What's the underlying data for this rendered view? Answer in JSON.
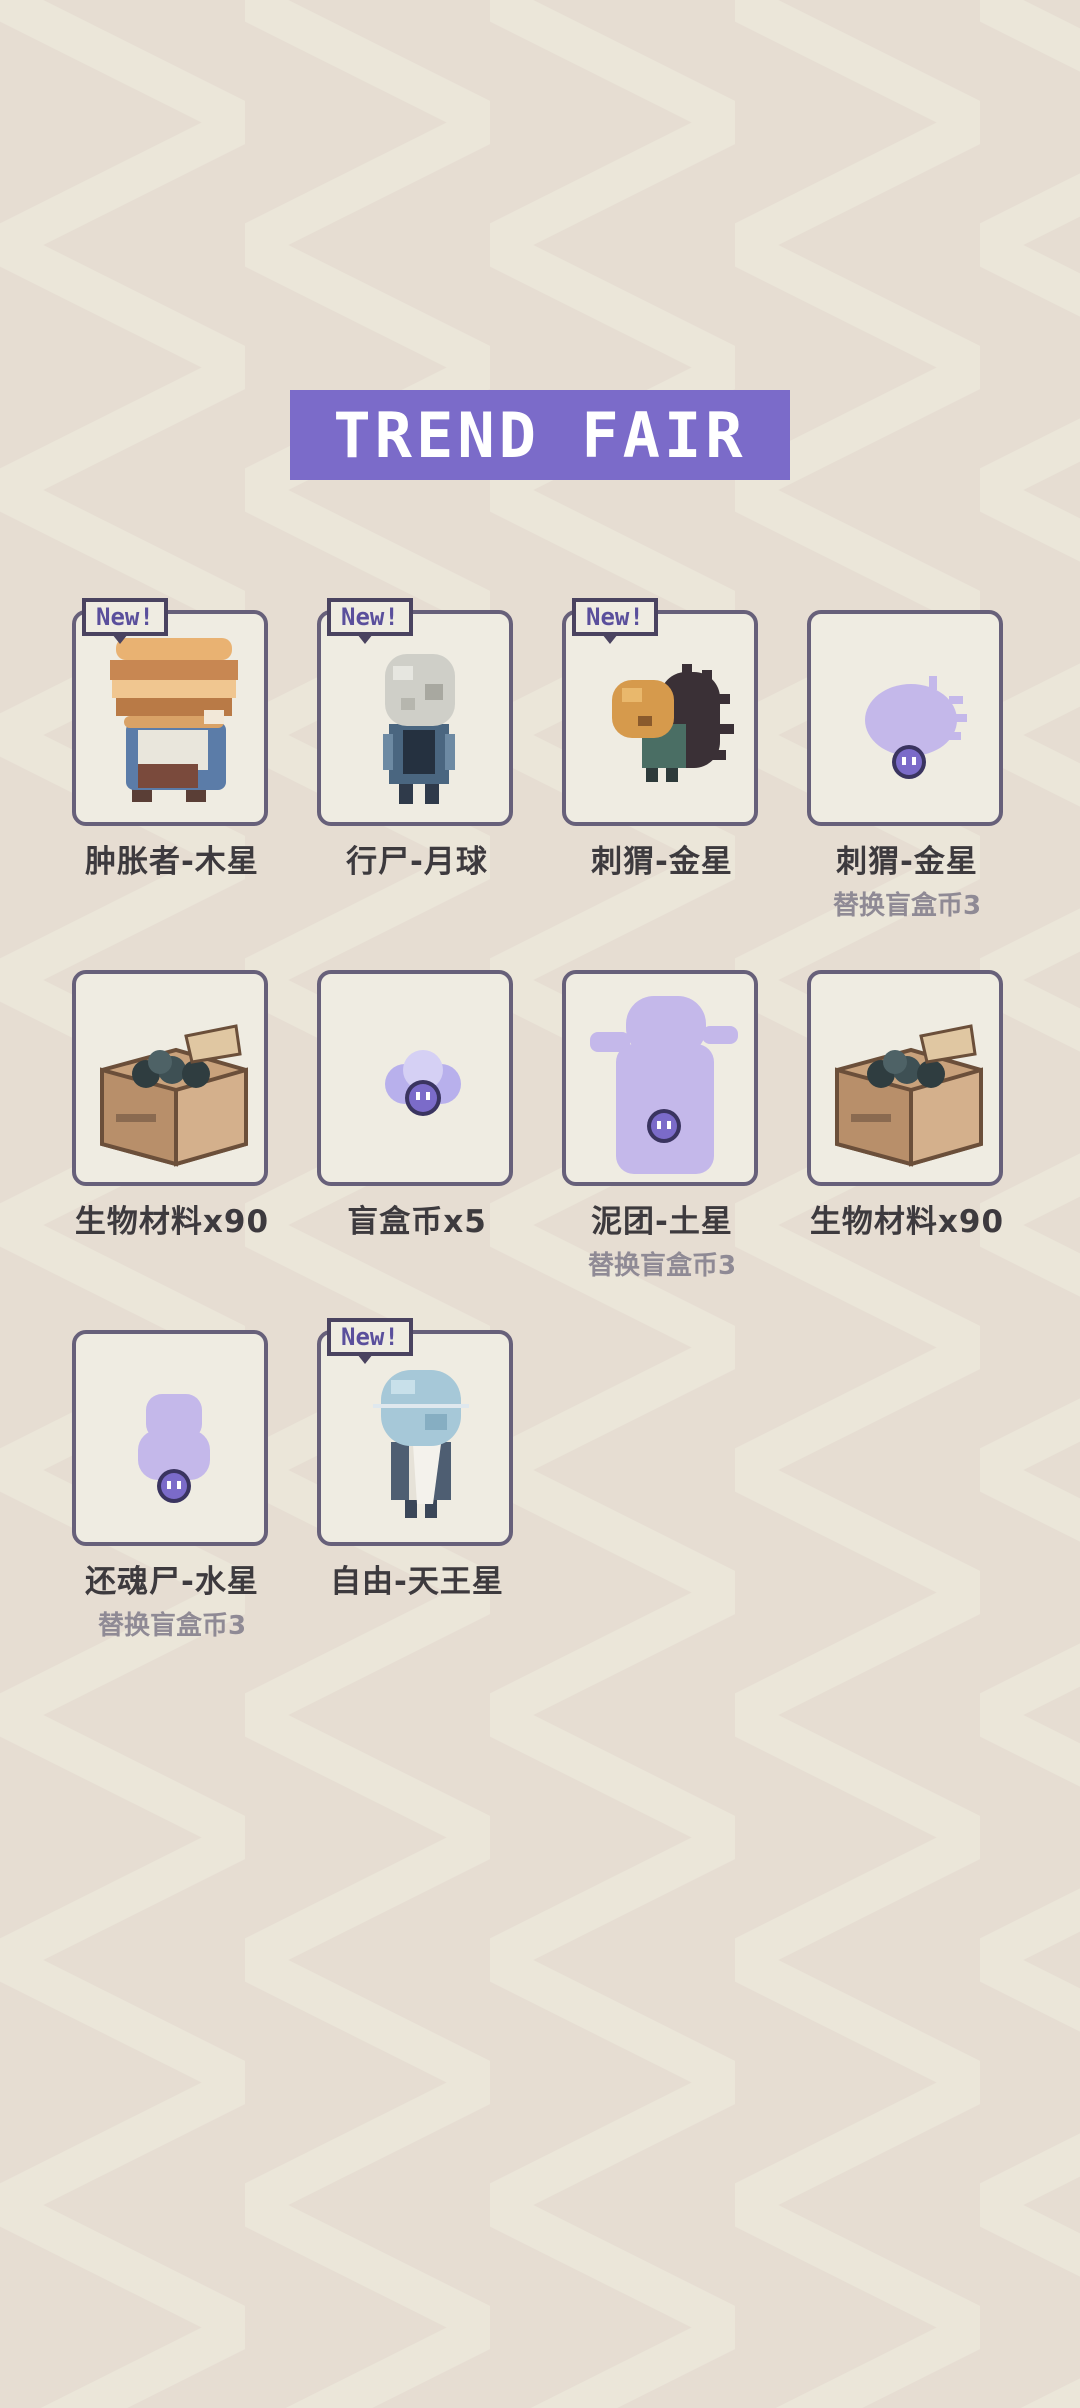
{
  "title": "TREND FAIR",
  "badge_text": "New!",
  "colors": {
    "accent": "#7b6bc9",
    "card_border": "#67607a",
    "card_bg": "#efece2",
    "ghost": "#c4b8ea"
  },
  "items": [
    {
      "name": "肿胀者-木星",
      "is_new": true,
      "icon": "jupiter-zombie-icon"
    },
    {
      "name": "行尸-月球",
      "is_new": true,
      "icon": "moon-zombie-icon"
    },
    {
      "name": "刺猬-金星",
      "is_new": true,
      "icon": "venus-hedgehog-icon"
    },
    {
      "name": "刺猬-金星",
      "is_new": false,
      "icon": "hedgehog-silhouette-icon",
      "sub": "替换盲盒币3"
    },
    {
      "name": "生物材料x90",
      "is_new": false,
      "icon": "bio-material-box-icon"
    },
    {
      "name": "盲盒币x5",
      "is_new": false,
      "icon": "blind-box-coins-icon"
    },
    {
      "name": "泥团-土星",
      "is_new": false,
      "icon": "mud-silhouette-icon",
      "sub": "替换盲盒币3"
    },
    {
      "name": "生物材料x90",
      "is_new": false,
      "icon": "bio-material-box-icon"
    },
    {
      "name": "还魂尸-水星",
      "is_new": false,
      "icon": "revenant-silhouette-icon",
      "sub": "替换盲盒币3"
    },
    {
      "name": "自由-天王星",
      "is_new": true,
      "icon": "uranus-freedom-icon"
    }
  ]
}
